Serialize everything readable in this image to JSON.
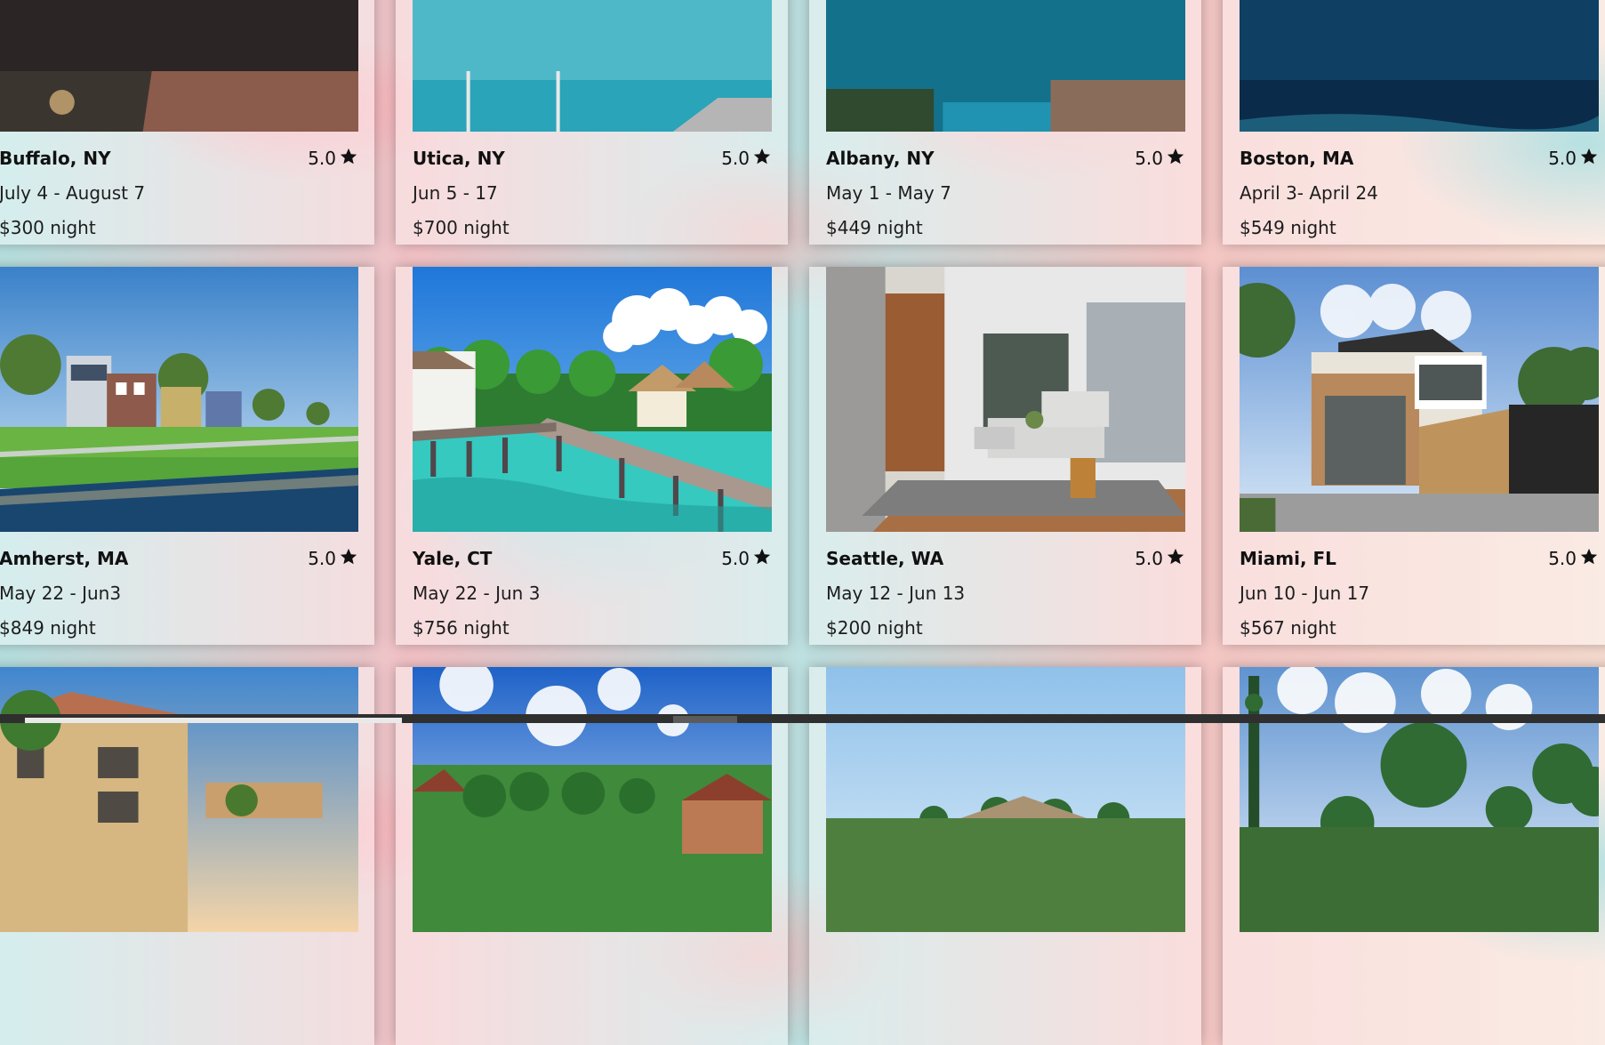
{
  "listings": [
    {
      "city": "Buffalo, NY",
      "rating": "5.0",
      "dates": "July 4 - August 7",
      "price": "$300 night"
    },
    {
      "city": "Utica, NY",
      "rating": "5.0",
      "dates": "Jun 5 - 17",
      "price": "$700 night"
    },
    {
      "city": "Albany, NY",
      "rating": "5.0",
      "dates": "May 1 - May 7",
      "price": "$449 night"
    },
    {
      "city": "Boston, MA",
      "rating": "5.0",
      "dates": "April 3- April 24",
      "price": "$549 night"
    },
    {
      "city": "Amherst, MA",
      "rating": "5.0",
      "dates": "May 22 - Jun3",
      "price": "$849 night"
    },
    {
      "city": "Yale, CT",
      "rating": "5.0",
      "dates": "May 22 - Jun 3",
      "price": "$756 night"
    },
    {
      "city": "Seattle, WA",
      "rating": "5.0",
      "dates": "May 12 - Jun 13",
      "price": "$200 night"
    },
    {
      "city": "Miami, FL",
      "rating": "5.0",
      "dates": "Jun 10 - Jun 17",
      "price": "$567 night"
    }
  ],
  "icons": {
    "rating": "star-icon"
  }
}
